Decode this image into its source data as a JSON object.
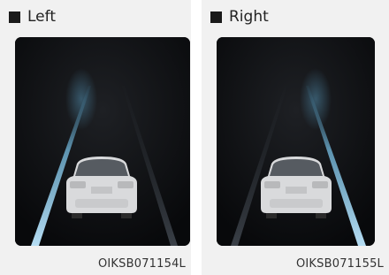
{
  "panels": [
    {
      "label": "Left",
      "code": "OIKSB071154L"
    },
    {
      "label": "Right",
      "code": "OIKSB071155L"
    }
  ]
}
